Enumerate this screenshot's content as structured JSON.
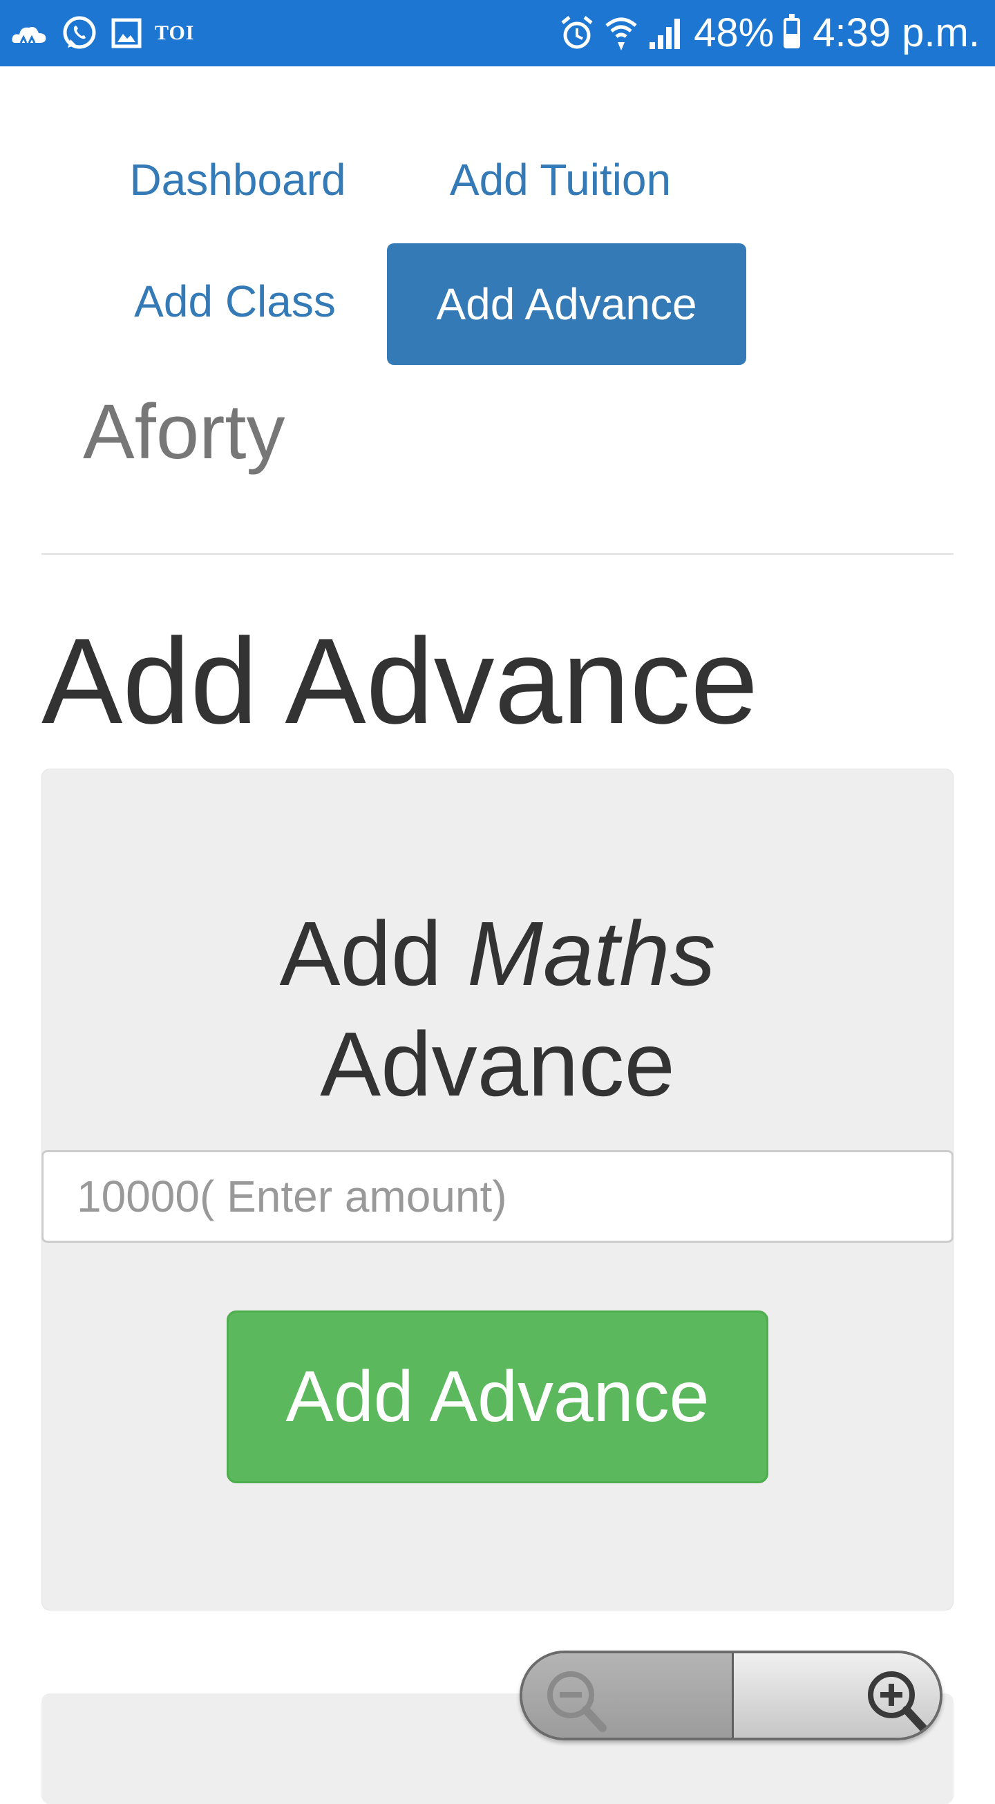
{
  "status_bar": {
    "notification_icons": [
      "cloud-icon",
      "whatsapp-icon",
      "gallery-icon"
    ],
    "toi_label": "TOI",
    "battery_percent": "48%",
    "battery_level": 0.48,
    "time": "4:39 p.m."
  },
  "nav": {
    "dashboard": "Dashboard",
    "add_tuition": "Add Tuition",
    "add_class": "Add Class",
    "add_advance": "Add Advance",
    "active_color": "#337ab7"
  },
  "brand": "Aforty",
  "page_title": "Add Advance",
  "card": {
    "title_prefix": "Add",
    "subject": "Maths",
    "title_suffix": "Advance",
    "amount_placeholder": "10000( Enter amount)",
    "submit_label": "Add Advance",
    "submit_color": "#5cb85c"
  },
  "zoom": {
    "out_icon": "zoom-out-icon",
    "in_icon": "zoom-in-icon"
  }
}
